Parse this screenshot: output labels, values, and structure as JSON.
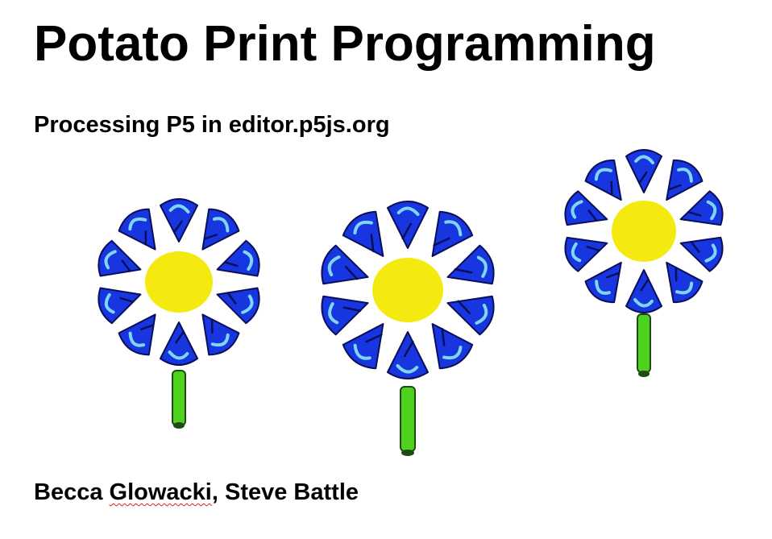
{
  "slide": {
    "title": "Potato Print Programming",
    "subtitle": "Processing P5 in editor.p5js.org",
    "authors": {
      "first_name": "Becca",
      "first_surname": "Glowacki",
      "separator": ",",
      "second": "Steve Battle"
    }
  },
  "flowers": [
    {
      "name": "flower-1",
      "petals": 10
    },
    {
      "name": "flower-2",
      "petals": 10
    },
    {
      "name": "flower-3",
      "petals": 10
    }
  ],
  "colors": {
    "petal_blue": "#1736e0",
    "petal_light": "#7fd6f2",
    "petal_dark": "#0a0f5a",
    "center_yellow": "#f4ea10",
    "stem_green": "#4fd21e",
    "stem_dark": "#1f4a16"
  }
}
